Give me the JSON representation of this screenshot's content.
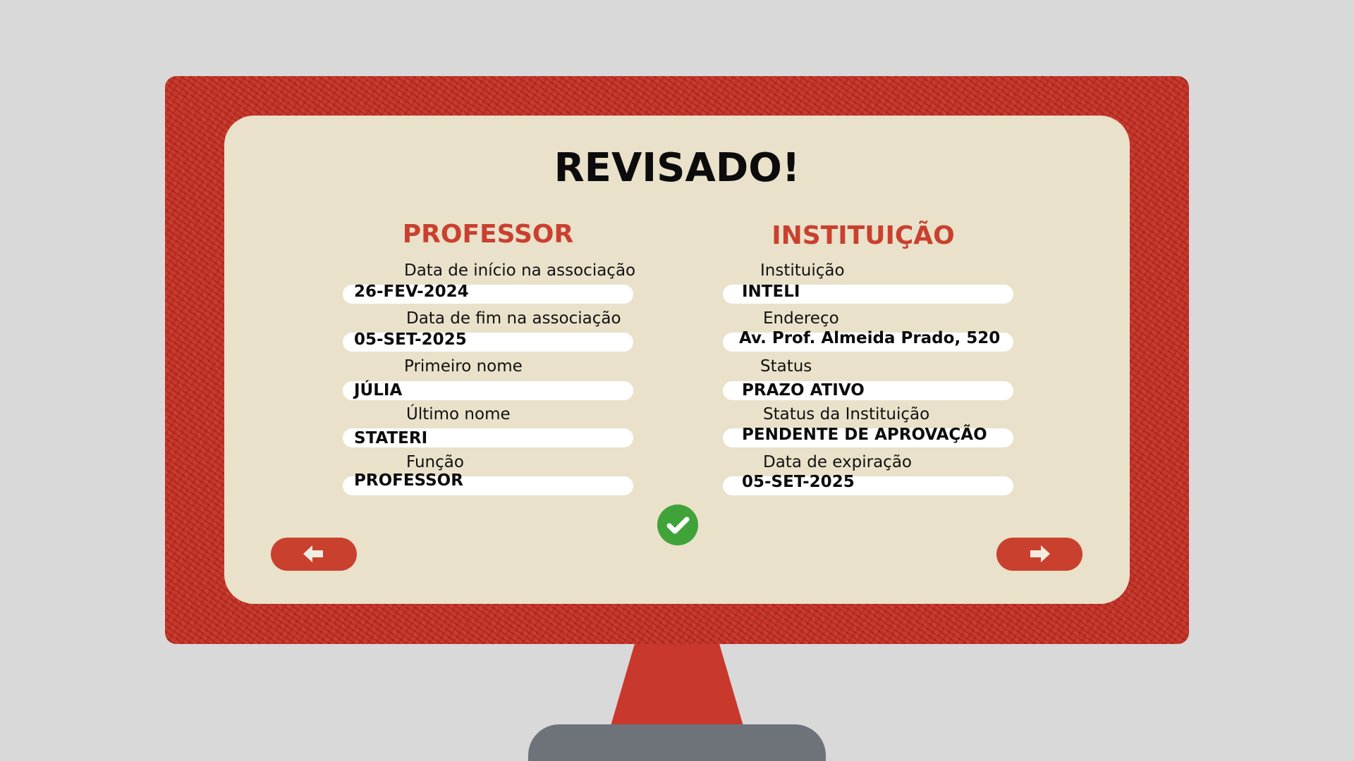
{
  "title": "REVISADO!",
  "professor": {
    "heading": "PROFESSOR",
    "fields": [
      {
        "label": "Data de início na associação",
        "value": "26-FEV-2024"
      },
      {
        "label": "Data de fim na associação",
        "value": "05-SET-2025"
      },
      {
        "label": "Primeiro nome",
        "value": "JÚLIA"
      },
      {
        "label": "Último nome",
        "value": "STATERI"
      },
      {
        "label": "Função",
        "value": "PROFESSOR"
      }
    ]
  },
  "instituicao": {
    "heading": "INSTITUIÇÃO",
    "fields": [
      {
        "label": "Instituição",
        "value": "INTELI"
      },
      {
        "label": "Endereço",
        "value": "Av. Prof. Almeida Prado, 520"
      },
      {
        "label": "Status",
        "value": "PRAZO ATIVO"
      },
      {
        "label": "Status da Instituição",
        "value": "PENDENTE DE APROVAÇÃO"
      },
      {
        "label": "Data de expiração",
        "value": "05-SET-2025"
      }
    ]
  },
  "icons": {
    "confirm": "check-circle-icon",
    "back": "arrow-left-icon",
    "next": "arrow-right-icon"
  },
  "colors": {
    "frame": "#c9382c",
    "screen": "#e9e1ca",
    "accent": "#c9402f",
    "success": "#3fa33a",
    "stand_base": "#6e737a"
  }
}
